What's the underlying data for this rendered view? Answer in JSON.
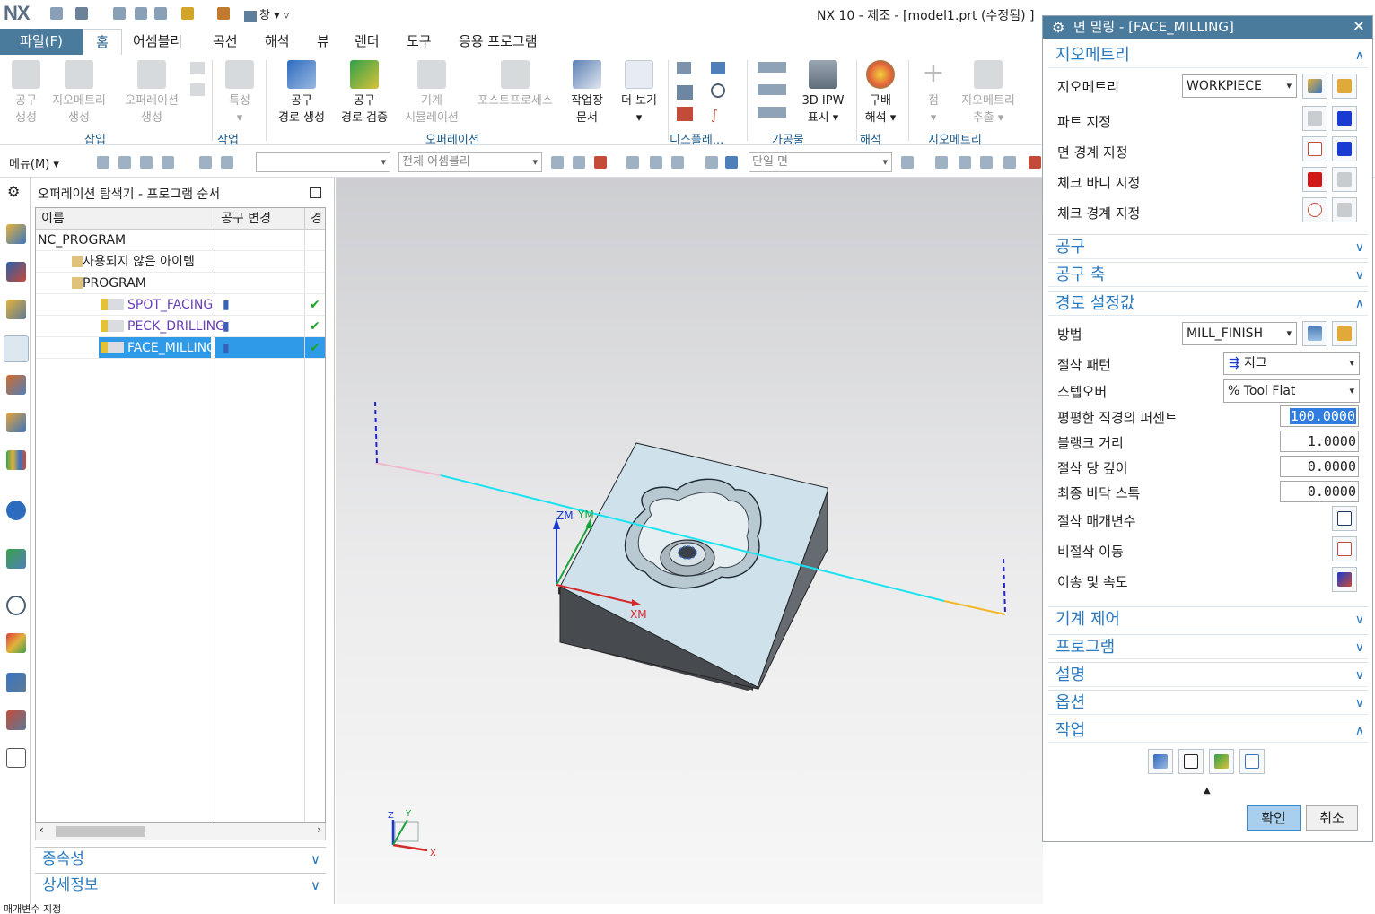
{
  "app": {
    "logo": "NX",
    "title": "NX 10 - 제조 - [model1.prt (수정됨) ]",
    "window_menu": "창"
  },
  "tabs": [
    "파일(F)",
    "홈",
    "어셈블리",
    "곡선",
    "해석",
    "뷰",
    "렌더",
    "도구",
    "응용 프로그램"
  ],
  "ribbon": {
    "buttons": [
      {
        "l1": "공구",
        "l2": "생성",
        "dis": true
      },
      {
        "l1": "지오메트리",
        "l2": "생성",
        "dis": true
      },
      {
        "l1": "오퍼레이션",
        "l2": "생성",
        "dis": true
      },
      {
        "l1": "특성",
        "l2": "▾",
        "dis": true
      },
      {
        "l1": "공구",
        "l2": "경로 생성",
        "dis": false
      },
      {
        "l1": "공구",
        "l2": "경로 검증",
        "dis": false
      },
      {
        "l1": "기계",
        "l2": "시뮬레이션",
        "dis": true
      },
      {
        "l1": "포스트프로세스",
        "l2": "",
        "dis": true
      },
      {
        "l1": "작업장",
        "l2": "문서",
        "dis": false
      },
      {
        "l1": "더 보기",
        "l2": "▾",
        "dis": false
      },
      {
        "l1": "3D IPW",
        "l2": "표시 ▾",
        "dis": false
      },
      {
        "l1": "구배",
        "l2": "해석 ▾",
        "dis": false
      },
      {
        "l1": "점",
        "l2": "▾",
        "dis": true
      },
      {
        "l1": "지오메트리",
        "l2": "추출 ▾",
        "dis": true
      }
    ],
    "groups": [
      "삽입",
      "작업",
      "오퍼레이션",
      "디스플레...",
      "가공물",
      "해석",
      "지오메트리"
    ]
  },
  "toolbar2": {
    "menu": "메뉴(M)",
    "combo_assembly": "전체 어셈블리",
    "combo_face": "단일 면"
  },
  "navigator": {
    "title": "오퍼레이션 탐색기 - 프로그램 순서",
    "columns": [
      "이름",
      "공구 변경",
      "경"
    ],
    "rows": [
      {
        "name": "NC_PROGRAM",
        "indent": 0,
        "chg": "",
        "ok": ""
      },
      {
        "name": "사용되지 않은 아이템",
        "indent": 1,
        "chg": "",
        "ok": ""
      },
      {
        "name": "PROGRAM",
        "indent": 1,
        "chg": "",
        "ok": ""
      },
      {
        "name": "SPOT_FACING",
        "indent": 2,
        "chg": "▮",
        "ok": "✔"
      },
      {
        "name": "PECK_DRILLING",
        "indent": 2,
        "chg": "▮",
        "ok": "✔"
      },
      {
        "name": "FACE_MILLING",
        "indent": 2,
        "chg": "▮",
        "ok": "✔"
      }
    ],
    "sections": [
      "종속성",
      "상세정보"
    ]
  },
  "viewport": {
    "axis_zm": "ZM",
    "axis_ym": "YM",
    "axis_xm": "XM",
    "triad_x": "X",
    "triad_y": "Y",
    "triad_z": "Z"
  },
  "dialog": {
    "title": "면 밀링 - [FACE_MILLING]",
    "geometry_section": "지오메트리",
    "geometry_label": "지오메트리",
    "geometry_value": "WORKPIECE",
    "part": "파트 지정",
    "face_boundary": "면 경계 지정",
    "check_body": "체크 바디 지정",
    "check_boundary": "체크 경계 지정",
    "tool_section": "공구",
    "tool_axis_section": "공구 축",
    "path_section": "경로 설정값",
    "method_label": "방법",
    "method_value": "MILL_FINISH",
    "cut_pattern_label": "절삭 패턴",
    "cut_pattern_value": "지그",
    "stepover_label": "스텝오버",
    "stepover_value": "% Tool Flat",
    "flat_pct_label": "평평한 직경의 퍼센트",
    "flat_pct_value": "100.0000",
    "blank_label": "블랭크 거리",
    "blank_value": "1.0000",
    "depth_label": "절삭 당 깊이",
    "depth_value": "0.0000",
    "floor_label": "최종 바닥 스톡",
    "floor_value": "0.0000",
    "cut_params": "절삭 매개변수",
    "non_cut": "비절삭 이동",
    "feeds": "이송 및 속도",
    "machine_control": "기계 제어",
    "program": "프로그램",
    "description": "설명",
    "options": "옵션",
    "actions": "작업",
    "ok": "확인",
    "cancel": "취소"
  },
  "status": "매개변수 지정"
}
